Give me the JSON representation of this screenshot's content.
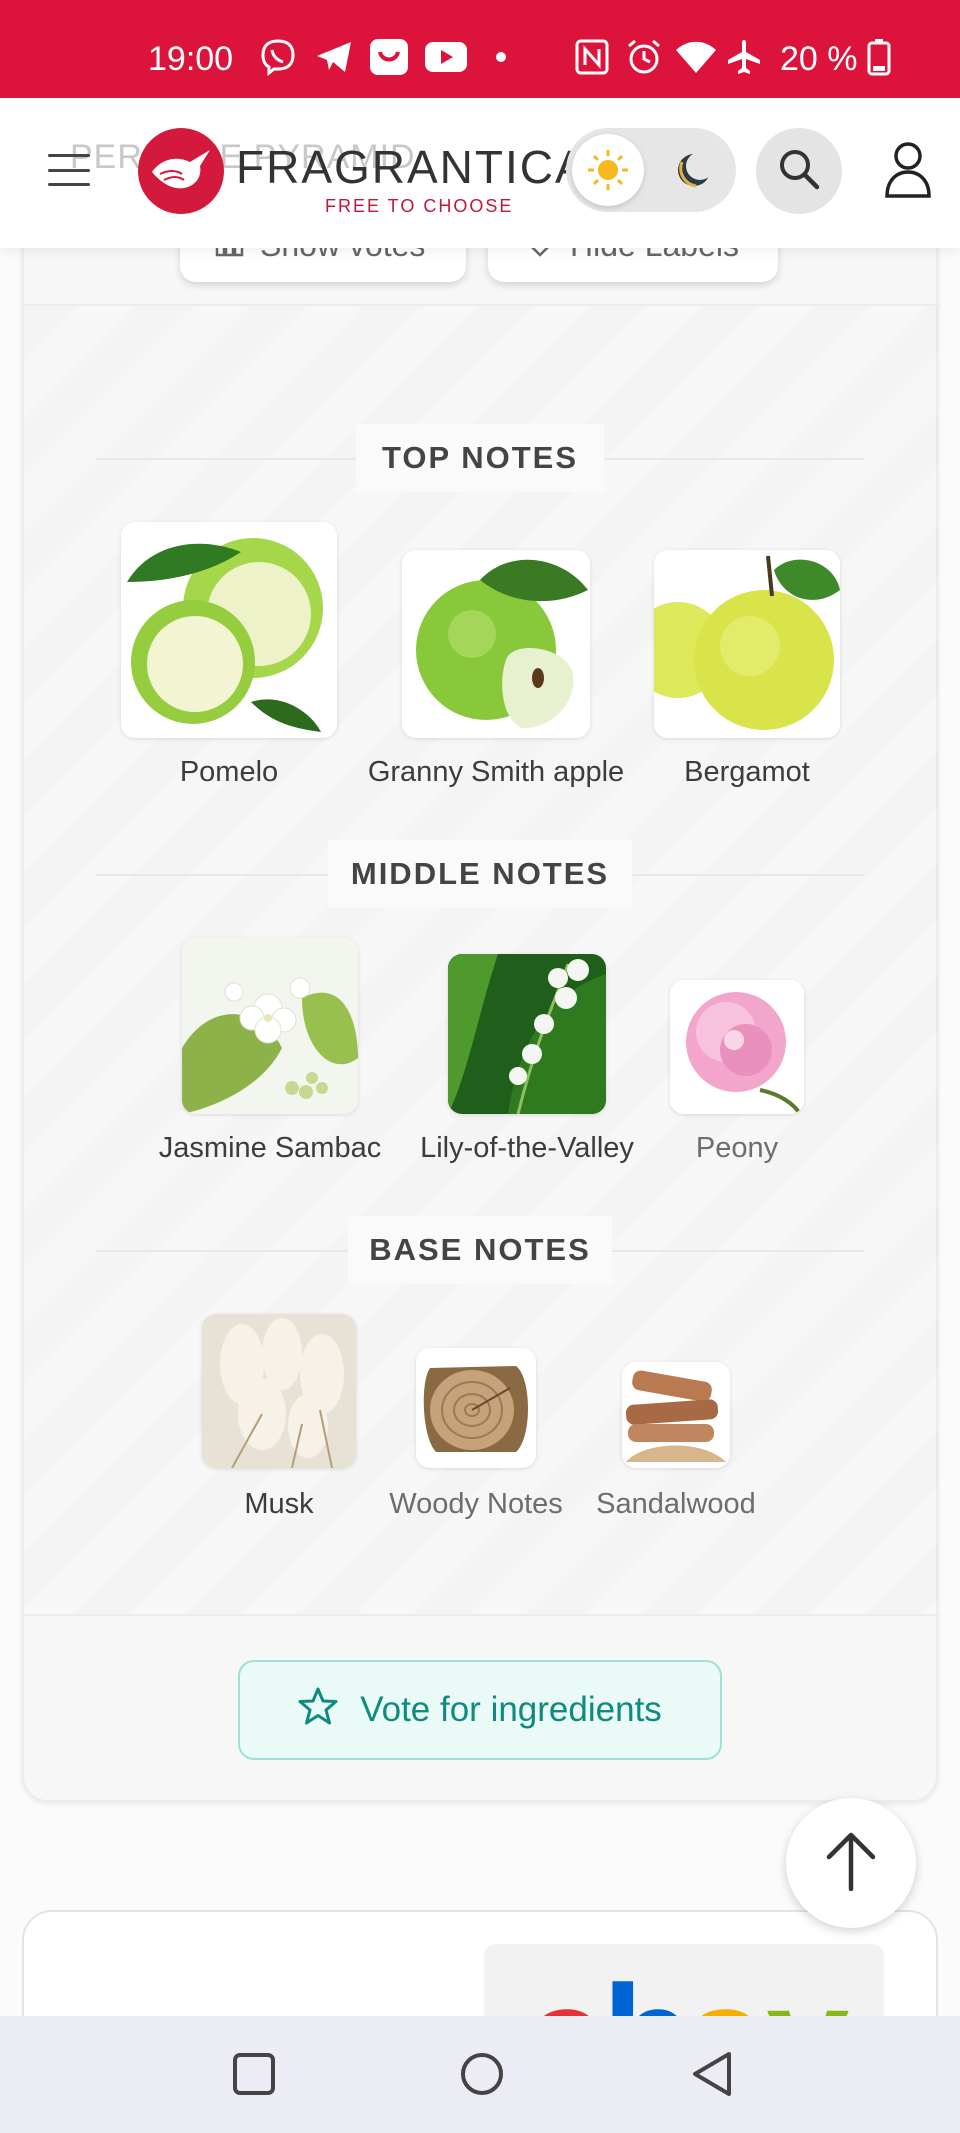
{
  "status_bar": {
    "time": "19:00",
    "battery": "20 %",
    "icons": [
      "viber-icon",
      "telegram-icon",
      "app-icon",
      "youtube-icon",
      "dot-icon",
      "nfc-icon",
      "alarm-icon",
      "wifi-icon",
      "airplane-icon",
      "battery-icon"
    ]
  },
  "header": {
    "ghost_title": "PERFUME PYRAMID",
    "logo_text": "FRAGRANTICA",
    "logo_tagline": "FREE TO CHOOSE",
    "theme_light_icon": "sun-icon",
    "theme_dark_icon": "moon-icon"
  },
  "controls": {
    "show_votes": "Show votes",
    "hide_labels": "Hide Labels"
  },
  "pyramid": {
    "top": {
      "title": "TOP NOTES",
      "notes": [
        "Pomelo",
        "Granny Smith apple",
        "Bergamot"
      ]
    },
    "middle": {
      "title": "MIDDLE NOTES",
      "notes": [
        "Jasmine Sambac",
        "Lily-of-the-Valley",
        "Peony"
      ]
    },
    "base": {
      "title": "BASE NOTES",
      "notes": [
        "Musk",
        "Woody Notes",
        "Sandalwood"
      ]
    }
  },
  "vote_button": "Vote for ingredients",
  "colors": {
    "brand": "#dc143c",
    "accent": "#0f8a7e",
    "accent_bg": "#e9faf7"
  }
}
